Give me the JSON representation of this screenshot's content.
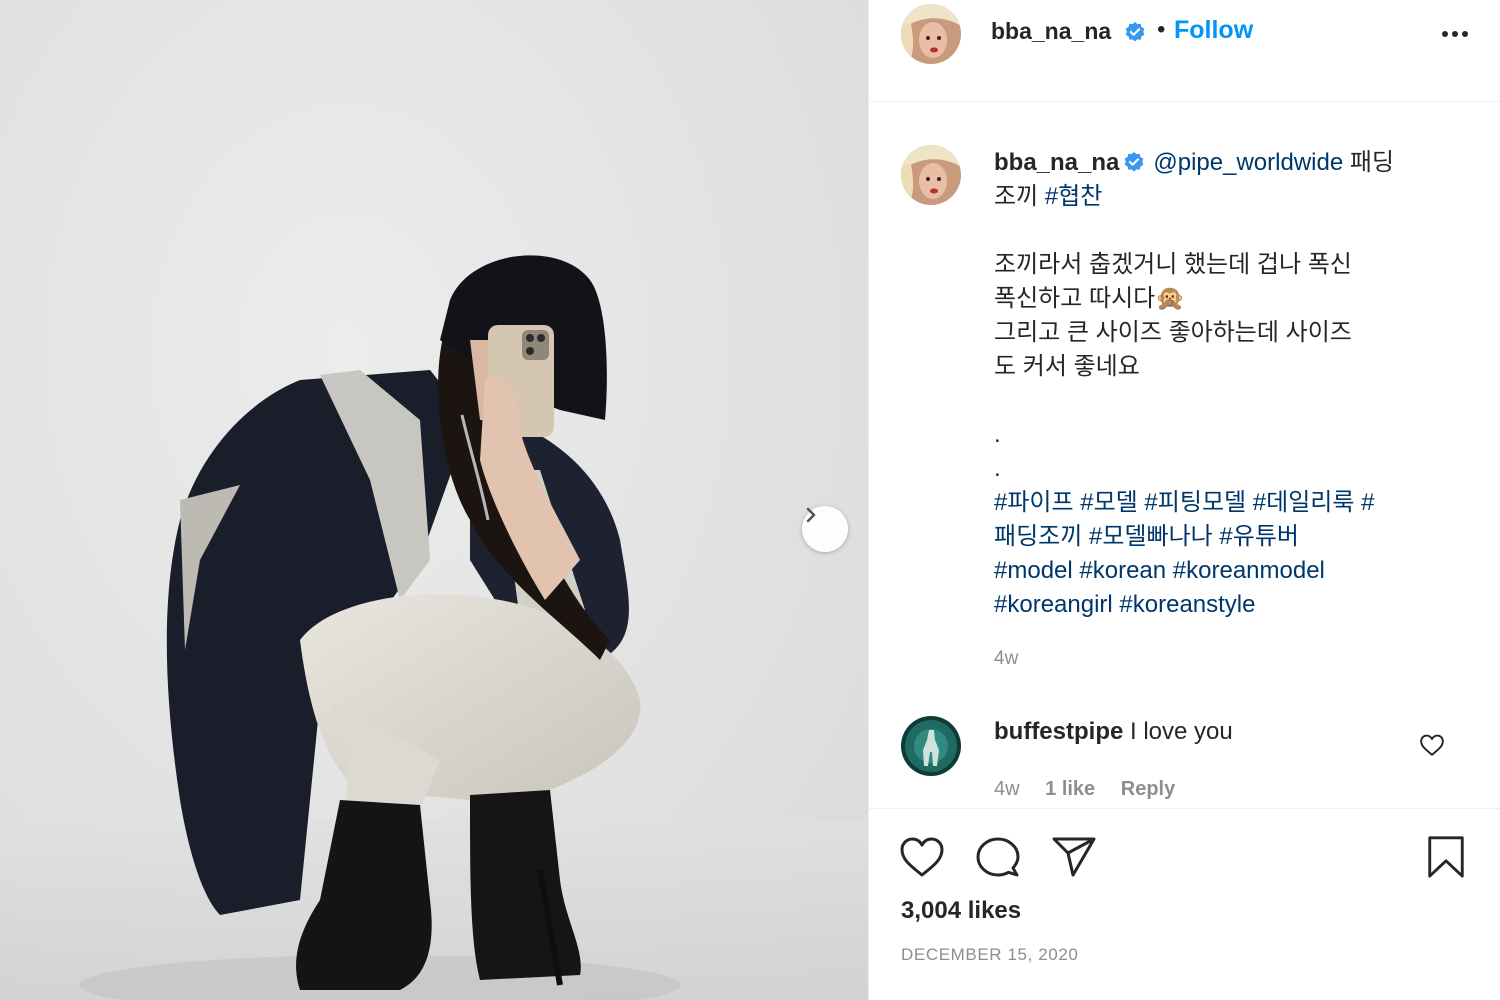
{
  "post": {
    "username": "bba_na_na",
    "follow_label": "Follow",
    "separator": "•",
    "caption": {
      "mention": "@pipe_worldwide",
      "line1_text": " 패딩",
      "line2_text": "조끼 ",
      "line2_tag": "#협찬",
      "body_lines": [
        "조끼라서 춥겠거니 했는데 겁나 폭신",
        "폭신하고 따시다🙊",
        "그리고 큰 사이즈 좋아하는데 사이즈",
        "도 커서 좋네요"
      ],
      "dots": [
        ".",
        "."
      ],
      "hashtag_lines": [
        "#파이프 #모델 #피팅모델 #데일리룩 #",
        "패딩조끼 #모델빠나나 #유튜버",
        "#model #korean #koreanmodel",
        "#koreangirl #koreanstyle"
      ],
      "time": "4w"
    },
    "comment": {
      "username": "buffestpipe",
      "text": "I love you",
      "time": "4w",
      "likes": "1 like",
      "reply": "Reply"
    },
    "likes": "3,004 likes",
    "date": "DECEMBER 15, 2020"
  },
  "icons": {
    "verified": "verified-badge-icon",
    "more": "more-options-icon",
    "next": "chevron-right-icon",
    "like": "heart-icon",
    "comment": "comment-icon",
    "share": "share-icon",
    "save": "bookmark-icon"
  },
  "colors": {
    "link_blue": "#0095f6",
    "hashtag": "#00376b",
    "verified": "#3897f0",
    "muted": "#8e8e8e"
  }
}
